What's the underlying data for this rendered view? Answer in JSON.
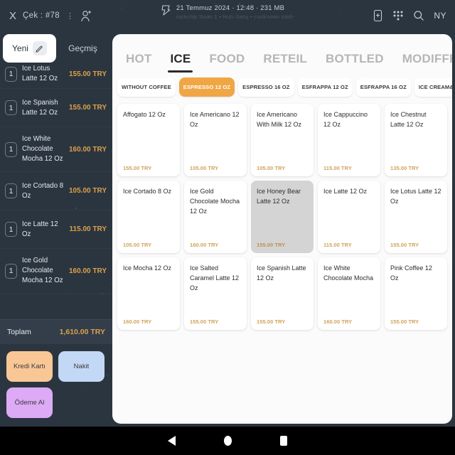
{
  "topbar": {
    "close_label": "X",
    "check_label": "Çek : #78",
    "kebab": "⋮",
    "person_icon": "add-person-icon",
    "device_icon": "device-icon",
    "info_line1": "21 Temmuz 2024  ·  12:48  ·  231 MB",
    "info_line2": "rockchip Swan 1 • Hızlı Satış • <unknown ssid>",
    "add_device_icon": "add-device-icon",
    "qr_icon": "qr-grid-icon",
    "search_icon": "search-icon",
    "user_label": "NY"
  },
  "sidebar": {
    "tabs": [
      {
        "label": "Yeni",
        "active": true
      },
      {
        "label": "Geçmiş",
        "active": false
      }
    ],
    "cart_items": [
      {
        "qty": "1",
        "name": "Ice Lotus Latte 12 Oz",
        "price": "155.00 TRY",
        "clipped": true
      },
      {
        "qty": "1",
        "name": "Ice Spanish Latte 12 Oz",
        "price": "155.00 TRY",
        "clipped": false
      },
      {
        "qty": "1",
        "name": "Ice White Chocolate Mocha 12 Oz",
        "price": "160.00 TRY",
        "clipped": false
      },
      {
        "qty": "1",
        "name": "Ice Cortado 8 Oz",
        "price": "105.00 TRY",
        "clipped": false
      },
      {
        "qty": "1",
        "name": "Ice Latte 12 Oz",
        "price": "115.00 TRY",
        "clipped": false
      },
      {
        "qty": "1",
        "name": "Ice Gold Chocolate Mocha 12 Oz",
        "price": "160.00 TRY",
        "clipped": false
      }
    ],
    "total_label": "Toplam",
    "total_value": "1,610.00 TRY",
    "payment_buttons": [
      {
        "label": "Kredi Kartı",
        "color": "#f8c795"
      },
      {
        "label": "Nakit",
        "color": "#c3d8f5"
      },
      {
        "label": "Ödeme Al",
        "color": "#ddaaf5"
      }
    ]
  },
  "main": {
    "tabs": [
      {
        "label": "HOT",
        "active": false
      },
      {
        "label": "ICE",
        "active": true
      },
      {
        "label": "FOOD",
        "active": false
      },
      {
        "label": "RETEIL",
        "active": false
      },
      {
        "label": "BOTTLED",
        "active": false
      },
      {
        "label": "MODIFFRES",
        "active": false
      }
    ],
    "chips": [
      {
        "label": "WITHOUT COFFEE",
        "active": false
      },
      {
        "label": "ESPRESSO 12 OZ",
        "active": true
      },
      {
        "label": "ESPRESSO 16 OZ",
        "active": false
      },
      {
        "label": "ESFRAPPA 12 OZ",
        "active": false
      },
      {
        "label": "ESFRAPPA 16 OZ",
        "active": false
      },
      {
        "label": "ICE CREAM&MILKSHAKE",
        "active": false
      }
    ],
    "products": [
      {
        "name": "Affogato 12 Oz",
        "price": "155.00 TRY",
        "pressed": false
      },
      {
        "name": "Ice Americano 12 Oz",
        "price": "105.00 TRY",
        "pressed": false
      },
      {
        "name": "Ice Americano With Milk 12 Oz",
        "price": "105.00 TRY",
        "pressed": false
      },
      {
        "name": "Ice Cappuccino 12 Oz",
        "price": "115.00 TRY",
        "pressed": false
      },
      {
        "name": "Ice Chestnut Latte 12 Oz",
        "price": "135.00 TRY",
        "pressed": false
      },
      {
        "name": "Ice Cortado 8 Oz",
        "price": "105.00 TRY",
        "pressed": false
      },
      {
        "name": "Ice Gold Chocolate Mocha 12 Oz",
        "price": "160.00 TRY",
        "pressed": false
      },
      {
        "name": "Ice Honey Bear Latte 12 Oz",
        "price": "155.00 TRY",
        "pressed": true
      },
      {
        "name": "Ice Latte 12 Oz",
        "price": "115.00 TRY",
        "pressed": false
      },
      {
        "name": "Ice Lotus Latte 12 Oz",
        "price": "155.00 TRY",
        "pressed": false
      },
      {
        "name": "Ice Mocha 12 Oz",
        "price": "160.00 TRY",
        "pressed": false
      },
      {
        "name": "Ice Salted Caramel Latte 12 Oz",
        "price": "155.00 TRY",
        "pressed": false
      },
      {
        "name": "Ice Spanish Latte 12 Oz",
        "price": "155.00 TRY",
        "pressed": false
      },
      {
        "name": "Ice White Chocolate Mocha",
        "price": "160.00 TRY",
        "pressed": false
      },
      {
        "name": "Pink Coffee 12 Oz",
        "price": "155.00 TRY",
        "pressed": false
      }
    ]
  },
  "navbar": {
    "back": "back-icon",
    "home": "home-icon",
    "recents": "recents-icon"
  },
  "colors": {
    "bg": "#2b3540",
    "accent_orange": "#f0a644",
    "price": "#cfa45c",
    "panel": "#fbfbfb"
  }
}
